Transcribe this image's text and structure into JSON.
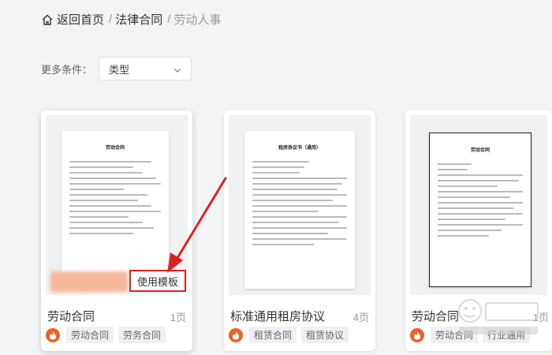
{
  "breadcrumb": {
    "home_label": "返回首页",
    "sep": "/",
    "category": "法律合同",
    "current": "劳动人事"
  },
  "filter": {
    "label": "更多条件：",
    "select_value": "类型"
  },
  "cards": [
    {
      "title": "劳动合同",
      "pages": "1页",
      "doc_title": "劳动合同",
      "tags": [
        "劳动合同",
        "劳务合同"
      ],
      "use_button": "使用模板"
    },
    {
      "title": "标准通用租房协议",
      "pages": "4页",
      "doc_title": "租房协议书（通用）",
      "tags": [
        "租赁合同",
        "租赁协议"
      ]
    },
    {
      "title": "劳动合同",
      "pages": "1页",
      "doc_title": "劳动合同",
      "tags": [
        "劳动合同",
        "行业通用"
      ]
    }
  ],
  "colors": {
    "brand": "#e8632a",
    "highlight": "#e02020"
  },
  "icons": {
    "home": "home-icon",
    "chevron": "chevron-down-icon",
    "brand": "brand-flame-icon"
  }
}
